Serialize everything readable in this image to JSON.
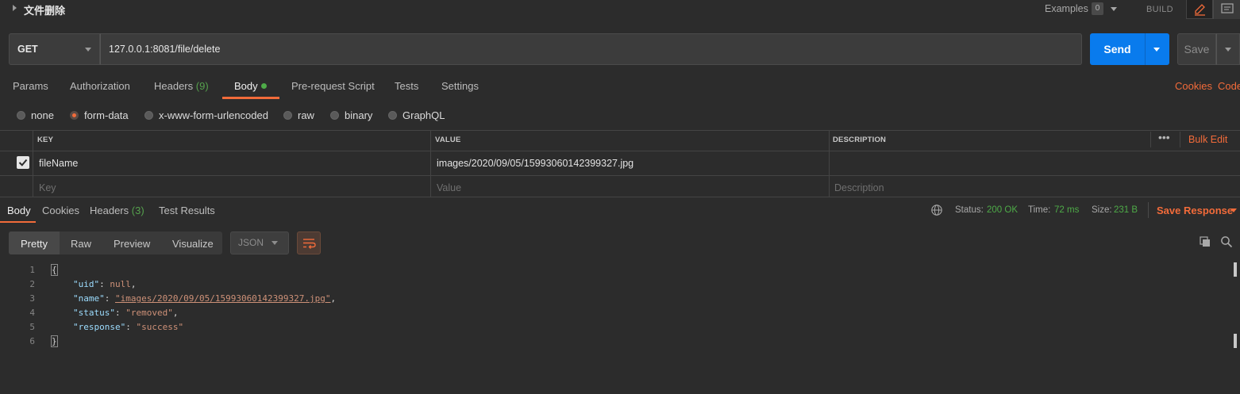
{
  "header": {
    "request_title": "文件删除",
    "examples_label": "Examples",
    "examples_count": "0",
    "build_label": "BUILD"
  },
  "url_bar": {
    "method": "GET",
    "url": "127.0.0.1:8081/file/delete",
    "send_label": "Send",
    "save_label": "Save"
  },
  "request_tabs": {
    "params": "Params",
    "authorization": "Authorization",
    "headers": "Headers",
    "headers_count": "(9)",
    "body": "Body",
    "pre_request": "Pre-request Script",
    "tests": "Tests",
    "settings": "Settings",
    "cookies": "Cookies",
    "code": "Code"
  },
  "body_types": {
    "options": [
      "none",
      "form-data",
      "x-www-form-urlencoded",
      "raw",
      "binary",
      "GraphQL"
    ],
    "selected": "form-data"
  },
  "form_table": {
    "headers": [
      "KEY",
      "VALUE",
      "DESCRIPTION"
    ],
    "bulk_edit": "Bulk Edit",
    "more": "•••",
    "rows": [
      {
        "checked": true,
        "key": "fileName",
        "value": "images/2020/09/05/15993060142399327.jpg",
        "description": ""
      }
    ],
    "placeholders": {
      "key": "Key",
      "value": "Value",
      "description": "Description"
    }
  },
  "response_tabs": {
    "body": "Body",
    "cookies": "Cookies",
    "headers": "Headers",
    "headers_count": "(3)",
    "test_results": "Test Results"
  },
  "status": {
    "status_label": "Status:",
    "status_value": "200 OK",
    "time_label": "Time:",
    "time_value": "72 ms",
    "size_label": "Size:",
    "size_value": "231 B",
    "save_response": "Save Response"
  },
  "view": {
    "pretty": "Pretty",
    "raw": "Raw",
    "preview": "Preview",
    "visualize": "Visualize",
    "format": "JSON"
  },
  "response_body": {
    "line_numbers": [
      "1",
      "2",
      "3",
      "4",
      "5",
      "6"
    ],
    "open_brace": "{",
    "close_brace": "}",
    "fields": [
      {
        "key": "\"uid\"",
        "value": "null",
        "trail": ","
      },
      {
        "key": "\"name\"",
        "value": "\"images/2020/09/05/15993060142399327.jpg\"",
        "trail": ","
      },
      {
        "key": "\"status\"",
        "value": "\"removed\"",
        "trail": ","
      },
      {
        "key": "\"response\"",
        "value": "\"success\"",
        "trail": ""
      }
    ]
  },
  "colors": {
    "accent": "#f26b3a",
    "send": "#097bed",
    "success": "#4eab48",
    "background": "#2c2c2c"
  }
}
